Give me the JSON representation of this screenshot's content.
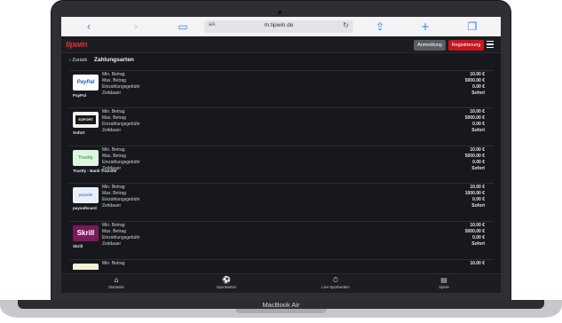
{
  "browser": {
    "text_size_label": "aA",
    "url": "m.tipwin.de",
    "icons": [
      "back-icon",
      "forward-icon",
      "bookmarks-icon",
      "reload-icon",
      "share-icon",
      "new-tab-icon",
      "tabs-icon"
    ]
  },
  "site": {
    "logo": "tipwin",
    "login_label": "Anmeldung",
    "register_label": "Registrierung",
    "brand_color": "#c8161e"
  },
  "page": {
    "back_label": "Zurück",
    "title": "Zahlungsarten"
  },
  "field_labels": [
    "Min. Betrag",
    "Max. Betrag",
    "Einzahlungsgebühr",
    "Zeitdauer"
  ],
  "payment_methods": [
    {
      "name": "PayPal",
      "logo_text": "PayPal",
      "min": "10.00 €",
      "max": "5000.00 €",
      "fee": "0.00 €",
      "duration": "Sofort"
    },
    {
      "name": "Sofort",
      "logo_text": "SOFORT",
      "min": "10.00 €",
      "max": "5000.00 €",
      "fee": "0.00 €",
      "duration": "Sofort"
    },
    {
      "name": "Trustly - Bank Transfer",
      "logo_text": "Trustly",
      "min": "10.00 €",
      "max": "5000.00 €",
      "fee": "0.00 €",
      "duration": "Sofort"
    },
    {
      "name": "paysafecard",
      "logo_text": "paysafe",
      "min": "10.00 €",
      "max": "1000.00 €",
      "fee": "0.00 €",
      "duration": "Sofort"
    },
    {
      "name": "Skrill",
      "logo_text": "Skrill",
      "min": "10.00 €",
      "max": "5000.00 €",
      "fee": "0.00 €",
      "duration": "Sofort"
    },
    {
      "name": "",
      "logo_text": "",
      "min": "10.00 €"
    }
  ],
  "tabbar": [
    {
      "label": "Startseite",
      "icon": "home-icon"
    },
    {
      "label": "Sportwetten",
      "icon": "soccer-ball-icon"
    },
    {
      "label": "Live-Sportwetten",
      "icon": "stopwatch-icon"
    },
    {
      "label": "Spiele",
      "icon": "slot-machine-icon"
    }
  ],
  "device": {
    "model": "MacBook Air"
  }
}
